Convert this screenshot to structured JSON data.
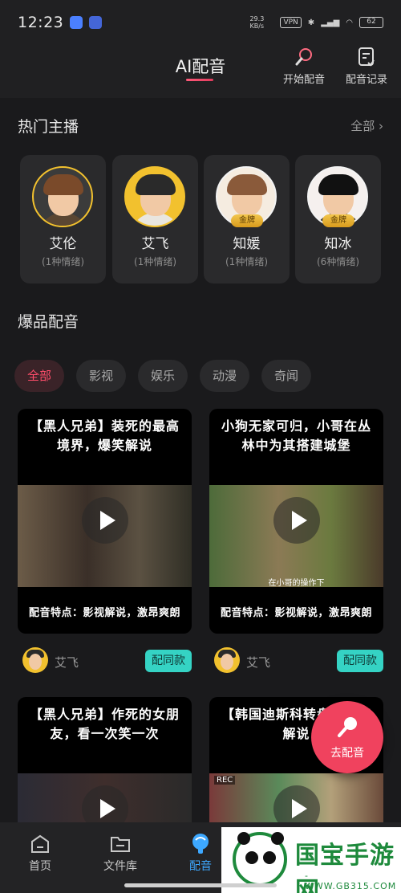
{
  "status": {
    "time": "12:23",
    "net_speed": "29.3 KB/s",
    "vpn": "VPN",
    "battery": "62"
  },
  "header": {
    "title": "AI配音",
    "actions": [
      {
        "label": "开始配音"
      },
      {
        "label": "配音记录"
      }
    ]
  },
  "hot_hosts": {
    "title": "热门主播",
    "see_all": "全部",
    "items": [
      {
        "name": "艾伦",
        "sub": "(1种情绪)",
        "badge": ""
      },
      {
        "name": "艾飞",
        "sub": "(1种情绪)",
        "badge": ""
      },
      {
        "name": "知媛",
        "sub": "(1种情绪)",
        "badge": "金牌"
      },
      {
        "name": "知冰",
        "sub": "(6种情绪)",
        "badge": "金牌"
      }
    ]
  },
  "hits": {
    "title": "爆品配音",
    "filters": [
      "全部",
      "影视",
      "娱乐",
      "动漫",
      "奇闻"
    ],
    "active_filter": "全部",
    "videos": [
      {
        "title": "【黑人兄弟】装死的最高境界，爆笑解说",
        "feature": "配音特点：影视解说，激昂爽朗",
        "author": "艾飞",
        "action": "配同款",
        "caption": ""
      },
      {
        "title": "小狗无家可归，小哥在丛林中为其搭建城堡",
        "feature": "配音特点：影视解说，激昂爽朗",
        "author": "艾飞",
        "action": "配同款",
        "caption": "在小哥的操作下"
      },
      {
        "title": "【黑人兄弟】作死的女朋友，看一次笑一次",
        "feature": "",
        "author": "",
        "action": "",
        "caption": ""
      },
      {
        "title": "【韩国迪斯科转盘】爆笑解说",
        "feature": "",
        "author": "",
        "action": "",
        "caption": "REC"
      }
    ]
  },
  "fab": {
    "label": "去配音"
  },
  "tabs": [
    {
      "label": "首页"
    },
    {
      "label": "文件库"
    },
    {
      "label": "配音"
    }
  ],
  "active_tab": "配音",
  "watermark": {
    "title": "国宝手游网",
    "url": "- WWW.GB315.COM -"
  },
  "colors": {
    "accent": "#ff4d6a",
    "teal": "#35d3c4",
    "gold": "#f2c12e",
    "tab_active": "#3da8ff"
  }
}
